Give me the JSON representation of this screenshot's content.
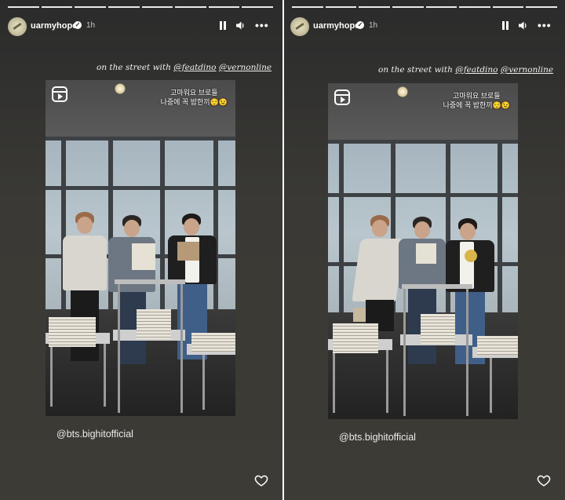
{
  "stories": [
    {
      "username": "uarmyhope",
      "time": "1h",
      "mention": {
        "prefix": "on the street with",
        "handles": [
          "@featdino",
          "@vernonline"
        ]
      },
      "reel_caption_line1": "고마워요 브로들",
      "reel_caption_line2": "나중에 꼭 밥한끼😌😉",
      "tag": "@bts.bighitofficial",
      "icons": [
        "verified-badge-icon",
        "pause-icon",
        "volume-icon",
        "more-icon",
        "reel-icon",
        "heart-icon"
      ]
    },
    {
      "username": "uarmyhope",
      "time": "1h",
      "mention": {
        "prefix": "on the street with",
        "handles": [
          "@featdino",
          "@vernonline"
        ]
      },
      "reel_caption_line1": "고마워요 브로들",
      "reel_caption_line2": "나중에 꼭 밥한끼😌😉",
      "tag": "@bts.bighitofficial",
      "icons": [
        "verified-badge-icon",
        "pause-icon",
        "volume-icon",
        "more-icon",
        "reel-icon",
        "heart-icon"
      ]
    }
  ],
  "colors": {
    "background": "#3a3935",
    "text": "#ffffff",
    "secondary_text": "#c8c8c8"
  },
  "progress_segments": 8
}
